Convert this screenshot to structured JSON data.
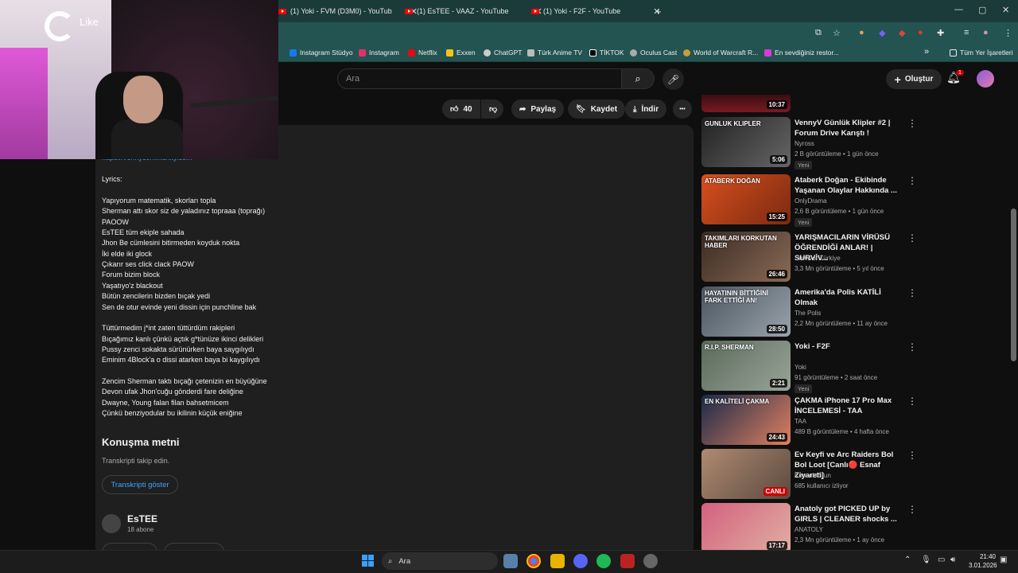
{
  "browser": {
    "tabs": [
      {
        "label": "(1) Yoki - FVM (D3M0) - YouTub",
        "close": "✕"
      },
      {
        "label": "(1) EsTEE - VAAZ - YouTube",
        "close": "✕"
      },
      {
        "label": "(1) Yoki - F2F - YouTube",
        "close": "✕"
      }
    ],
    "new_tab": "+",
    "window_controls": [
      "—",
      "▢",
      "✕"
    ],
    "bookmarks": [
      {
        "label": "Instagram Stüdyo",
        "color": "#1877f2"
      },
      {
        "label": "Instagram",
        "color": "#e1306c"
      },
      {
        "label": "Netflix",
        "color": "#e50914"
      },
      {
        "label": "Exxen",
        "color": "#f5c518"
      },
      {
        "label": "ChatGPT",
        "color": "#cccccc"
      },
      {
        "label": "Türk Anime TV",
        "color": "#bbbbbb"
      },
      {
        "label": "TİKTOK",
        "color": "#111111"
      },
      {
        "label": "Oculus Cast",
        "color": "#aaaaaa"
      },
      {
        "label": "World of Warcraft R...",
        "color": "#c79c3e"
      },
      {
        "label": "En sevdiğiniz restor...",
        "color": "#d93ad9"
      }
    ],
    "bookmarks_more": "»",
    "all_bookmarks": "Tüm Yer İşaretleri"
  },
  "youtube": {
    "search_placeholder": "Ara",
    "create_label": "Oluştur",
    "notification_count": "1",
    "actions": {
      "like_count": "40",
      "share": "Paylaş",
      "save": "Kaydet",
      "download": "İndir",
      "more": "•••"
    },
    "description": {
      "cut_line": "https://vennycommunity.com",
      "lyrics_header": "Lyrics:",
      "lyrics": [
        "Yapıyorum matematik, skorları topla",
        "Sherman attı skor siz de yaladınız topraaa (toprağı)",
        "PAOOW",
        "EsTEE tüm ekiple sahada",
        "Jhon Be cümlesini bitirmeden koyduk nokta",
        "İki elde iki glock",
        "Çıkarır ses click clack PAOW",
        "Forum bizim block",
        "Yaşatıyo'z blackout",
        "Bütün zencilerin bizden bıçak yedi",
        "Sen de otur evinde yeni dissin için punchline bak",
        "",
        "Tüttürmedim j*int zaten tüttürdüm rakipleri",
        "Bıçağımız kanlı çünkü açtık g*tünüze ikinci delikleri",
        "Pussy zenci sokakta sürünürken baya saygılıydı",
        "Eminim 4Block'a o dissi atarken baya bi kaygılıydı",
        "",
        "Zencim Sherman taktı bıçağı çetenizin en büyüğüne",
        "Devon ufak Jhon'cuğu gönderdi fare deliğine",
        "Dwayne, Young falan filan bahsetmicem",
        "Çünkü benziyodular bu ikilinin küçük eniğine"
      ],
      "transcript_title": "Konuşma metni",
      "transcript_sub": "Transkripti takip edin.",
      "transcript_button": "Transkripti göster",
      "channel_name": "EsTEE",
      "channel_subs": "18 abone"
    },
    "sidebar": [
      {
        "duration": "10:37",
        "title": "",
        "channel": "",
        "meta": "",
        "badge": ""
      },
      {
        "duration": "5:06",
        "title": "VennyV Günlük Klipler #2 | Forum Drive Karıştı !",
        "channel": "Nyross",
        "meta": "2 B görüntüleme • 1 gün önce",
        "badge": "Yeni",
        "thumb_text": "GUNLUK KLIPLER"
      },
      {
        "duration": "15:25",
        "title": "Ataberk Doğan - Ekibinde Yaşanan Olaylar Hakkında ...",
        "channel": "OnlyDrama",
        "meta": "2,6 B görüntüleme • 1 gün önce",
        "badge": "Yeni",
        "thumb_text": "ATABERK DOĞAN"
      },
      {
        "duration": "26:46",
        "title": "YARIŞMACILARIN VİRÜSÜ ÖĞRENDİĞİ ANLAR! | SURVİV...",
        "channel": "Survivor Türkiye",
        "meta": "3,3 Mn görüntüleme • 5 yıl önce",
        "badge": "",
        "thumb_text": "TAKIMLARI KORKUTAN HABER"
      },
      {
        "duration": "28:50",
        "title": "Amerika'da Polis KATİLİ Olmak",
        "channel": "The Polis",
        "meta": "2,2 Mn görüntüleme • 11 ay önce",
        "badge": "",
        "thumb_text": "HAYATININ BİTTİĞİNİ FARK ETTİĞİ AN!"
      },
      {
        "duration": "2:21",
        "title": "Yoki - F2F",
        "channel": "Yoki",
        "meta": "91 görüntüleme • 2 saat önce",
        "badge": "Yeni",
        "thumb_text": "R.I.P. SHERMAN"
      },
      {
        "duration": "24:43",
        "title": "ÇAKMA iPhone 17 Pro Max İNCELEMESİ - TAA",
        "channel": "TAA",
        "meta": "489 B görüntüleme • 4 hafta önce",
        "badge": "",
        "thumb_text": "EN KALİTELİ ÇAKMA"
      },
      {
        "duration": "CANLI",
        "title": "Ev Keyfi ve Arc Raiders Bol Bol Loot [Canlı🔴 Esnaf Ziyareti]",
        "channel": "Konsol Oyun",
        "meta": "685 kullanıcı izliyor",
        "badge": "",
        "thumb_text": ""
      },
      {
        "duration": "17:17",
        "title": "Anatoly got PICKED UP by GIRLS | CLEANER shocks ...",
        "channel": "ANATOLY",
        "meta": "2,3 Mn görüntüleme • 1 ay önce",
        "badge": "",
        "thumb_text": ""
      }
    ]
  },
  "overlay": {
    "like_text": "Like"
  },
  "taskbar": {
    "search": "Ara",
    "time": "21:40",
    "date": "3.01.2026"
  }
}
